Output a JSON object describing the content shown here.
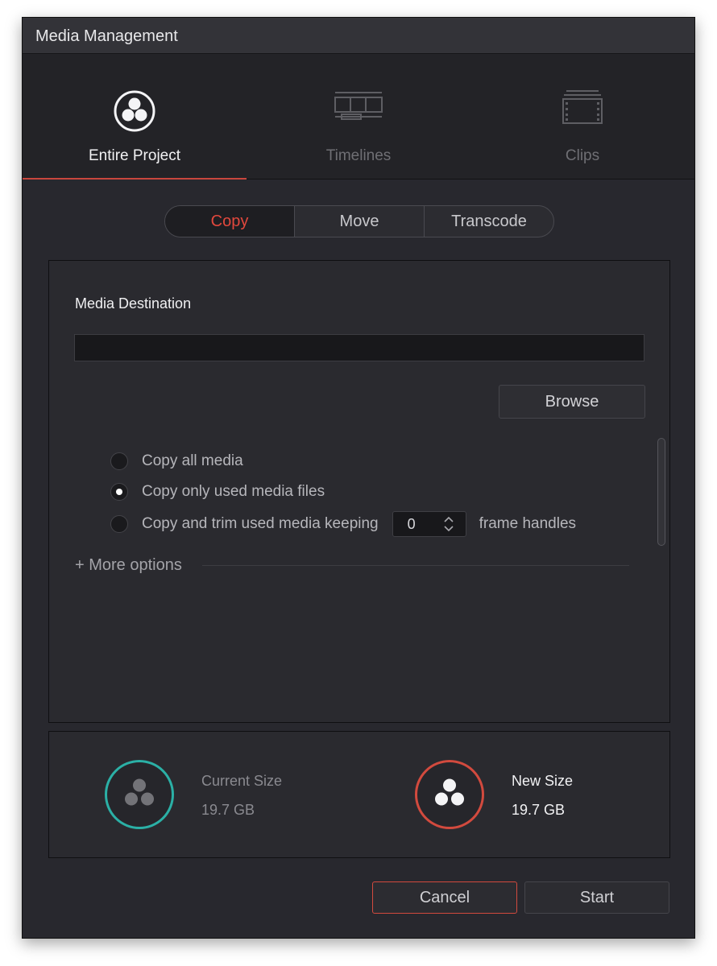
{
  "window": {
    "title": "Media Management"
  },
  "tabs": [
    {
      "label": "Entire Project",
      "icon": "resolve-logo-icon",
      "active": true
    },
    {
      "label": "Timelines",
      "icon": "timeline-icon",
      "active": false
    },
    {
      "label": "Clips",
      "icon": "film-clip-icon",
      "active": false
    }
  ],
  "modes": [
    {
      "label": "Copy",
      "active": true
    },
    {
      "label": "Move",
      "active": false
    },
    {
      "label": "Transcode",
      "active": false
    }
  ],
  "destination": {
    "heading": "Media Destination",
    "value": "",
    "browse_label": "Browse"
  },
  "options": {
    "copy_all": "Copy all media",
    "copy_used": "Copy only used media files",
    "copy_trim": "Copy and trim used media keeping",
    "selected": "copy_used",
    "frame_handles_value": "0",
    "frame_handles_label": "frame handles",
    "more_options": "+ More options"
  },
  "sizes": {
    "current_label": "Current Size",
    "current_value": "19.7 GB",
    "new_label": "New Size",
    "new_value": "19.7 GB"
  },
  "buttons": {
    "cancel": "Cancel",
    "start": "Start"
  },
  "colors": {
    "accent_red": "#d24a3e",
    "teal": "#2bb0a6",
    "active_text": "#e2483d"
  }
}
